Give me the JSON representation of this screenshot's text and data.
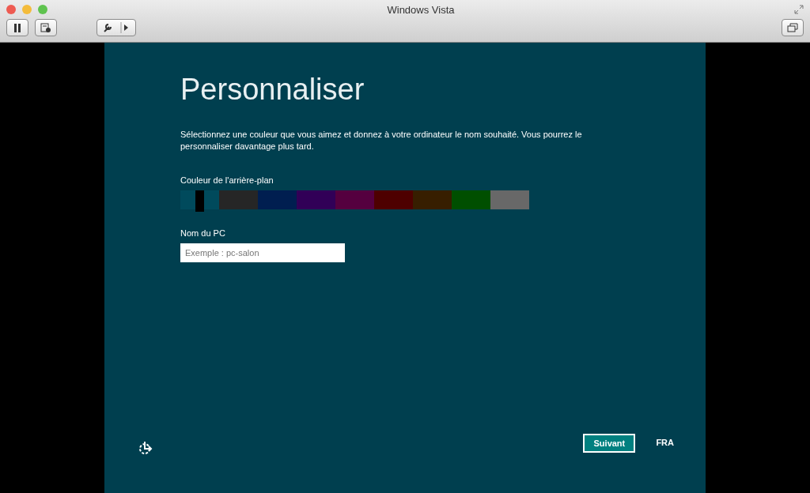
{
  "window": {
    "title": "Windows Vista"
  },
  "page": {
    "title": "Personnaliser",
    "description": "Sélectionnez une couleur que vous aimez et donnez à votre ordinateur le nom souhaité. Vous pourrez le personnaliser davantage plus tard.",
    "color_label": "Couleur de l'arrière-plan",
    "swatches": [
      {
        "color": "#004a5c",
        "selected": true
      },
      {
        "color": "#262626",
        "selected": false
      },
      {
        "color": "#001e50",
        "selected": false
      },
      {
        "color": "#310057",
        "selected": false
      },
      {
        "color": "#55003f",
        "selected": false
      },
      {
        "color": "#4e0000",
        "selected": false
      },
      {
        "color": "#371e00",
        "selected": false
      },
      {
        "color": "#004f00",
        "selected": false
      },
      {
        "color": "#686868",
        "selected": false
      }
    ],
    "name_label": "Nom du PC",
    "name_field": {
      "placeholder": "Exemple : pc-salon"
    },
    "next_button": "Suivant",
    "language": "FRA"
  }
}
